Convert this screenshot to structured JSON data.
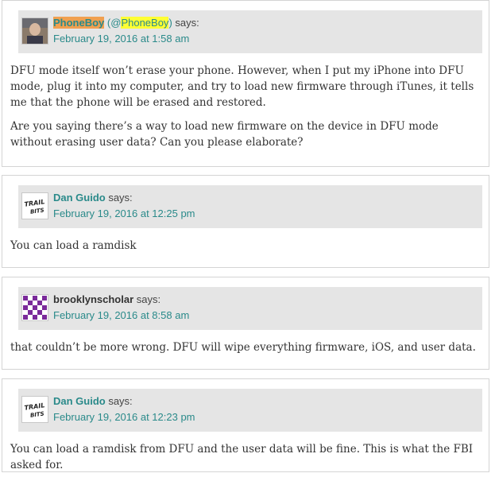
{
  "comments": [
    {
      "author": "PhoneBoy",
      "handle_prefix": " (@",
      "handle": "PhoneBoy",
      "handle_suffix": ")",
      "says": " says:",
      "date": "February 19, 2016 at 1:58 am",
      "paragraphs": [
        "DFU mode itself won’t erase your phone. However, when I put my iPhone into DFU mode, plug it into my computer, and try to load new firmware through iTunes, it tells me that the phone will be erased and restored.",
        "Are you saying there’s a way to load new firmware on the device in DFU mode without erasing user data? Can you please elaborate?"
      ]
    },
    {
      "author": "Dan Guido",
      "says": " says:",
      "date": "February 19, 2016 at 12:25 pm",
      "avatar_text": "TRAIL OF BITS",
      "paragraphs": [
        "You can load a ramdisk"
      ]
    },
    {
      "author": "brooklynscholar",
      "says": " says:",
      "date": "February 19, 2016 at 8:58 am",
      "paragraphs": [
        "that couldn’t be more wrong. DFU will wipe everything firmware, iOS, and user data."
      ]
    },
    {
      "author": "Dan Guido",
      "says": " says:",
      "date": "February 19, 2016 at 12:23 pm",
      "avatar_text": "TRAIL OF BITS",
      "paragraphs": [
        "You can load a ramdisk from DFU and the user data will be fine. This is what the FBI asked for."
      ]
    }
  ],
  "colors": {
    "link": "#2a8a8a",
    "meta_bg": "#e5e5e5",
    "highlight_orange": "#f0a050",
    "highlight_yellow": "#ffff33"
  }
}
